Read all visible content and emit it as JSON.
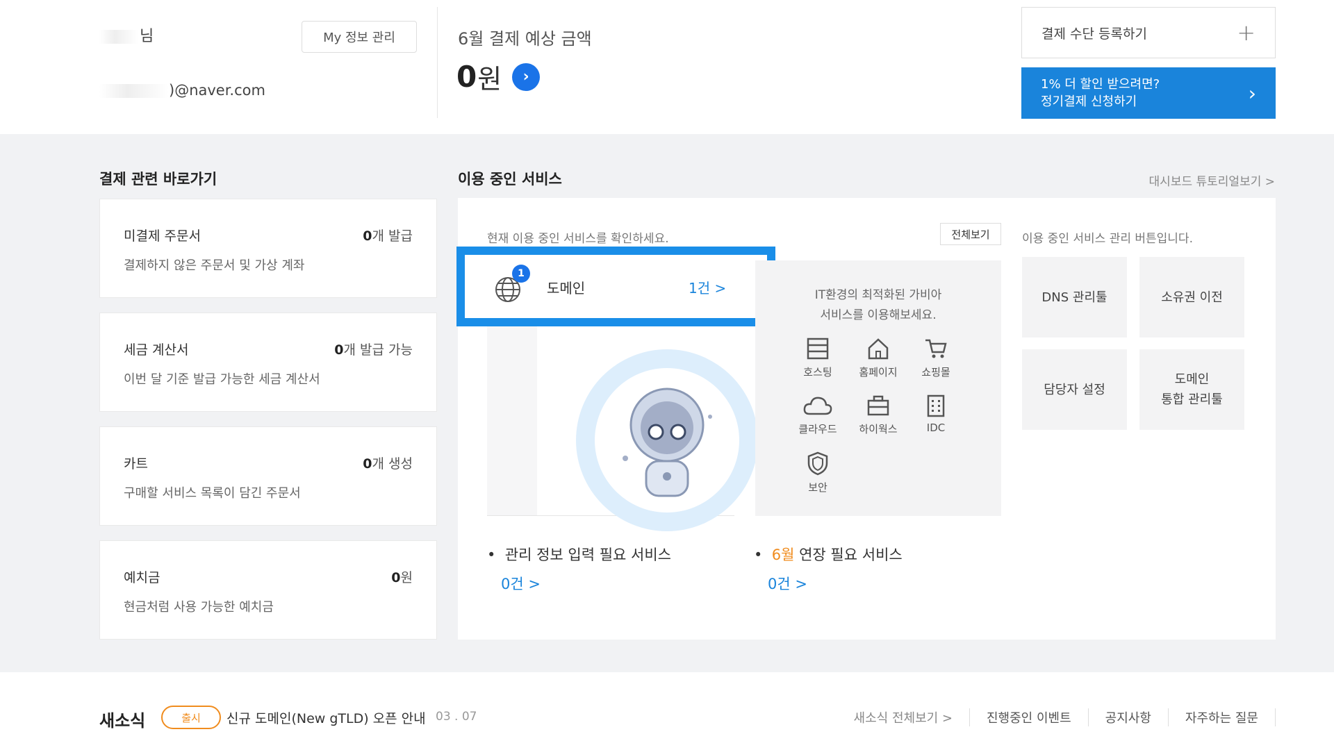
{
  "header": {
    "user_name_suffix": "님",
    "user_email_suffix": ")@naver.com",
    "myinfo_button": "My 정보 관리",
    "payment_title": "6월 결제 예상 금액",
    "payment_amount": "0",
    "payment_unit": "원",
    "register_payment": "결제 수단 등록하기",
    "discount_line1": "1% 더 할인 받으려면?",
    "discount_line2": "정기결제 신청하기"
  },
  "shortcuts": {
    "title": "결제 관련 바로가기",
    "cards": [
      {
        "label": "미결제 주문서",
        "value": "0",
        "value_suffix": "개 발급",
        "desc": "결제하지 않은 주문서 및 가상 계좌"
      },
      {
        "label": "세금 계산서",
        "value": "0",
        "value_suffix": "개 발급 가능",
        "desc": "이번 달 기준 발급 가능한 세금 계산서"
      },
      {
        "label": "카트",
        "value": "0",
        "value_suffix": "개 생성",
        "desc": "구매할 서비스 목록이 담긴 주문서"
      },
      {
        "label": "예치금",
        "value": "0",
        "value_suffix": "원",
        "desc": "현금처럼 사용 가능한 예치금"
      }
    ]
  },
  "services": {
    "title": "이용 중인 서비스",
    "tutorial_link": "대시보드 튜토리얼보기 >",
    "hint": "현재 이용 중인 서비스를 확인하세요.",
    "view_all": "전체보기",
    "mgmt_hint": "이용 중인 서비스 관리 버튼입니다.",
    "domain": {
      "badge": "1",
      "label": "도메인",
      "count": "1건 >"
    },
    "it_desc_line1": "IT환경의 최적화된 가비아",
    "it_desc_line2": "서비스를 이용해보세요.",
    "it_items": [
      {
        "label": "호스팅",
        "icon": "hosting-icon"
      },
      {
        "label": "홈페이지",
        "icon": "home-icon"
      },
      {
        "label": "쇼핑몰",
        "icon": "cart-icon"
      },
      {
        "label": "클라우드",
        "icon": "cloud-icon"
      },
      {
        "label": "하이웍스",
        "icon": "briefcase-icon"
      },
      {
        "label": "IDC",
        "icon": "server-icon"
      },
      {
        "label": "보안",
        "icon": "shield-icon"
      }
    ],
    "mgmt_buttons": [
      {
        "label": "DNS 관리툴"
      },
      {
        "label": "소유권 이전"
      },
      {
        "label": "담당자 설정"
      },
      {
        "label": "도메인\n통합 관리툴"
      }
    ],
    "footer": {
      "info_label": "관리 정보 입력 필요 서비스",
      "info_count": "0건 >",
      "renew_month": "6월",
      "renew_label": " 연장 필요 서비스",
      "renew_count": "0건 >"
    }
  },
  "news": {
    "title": "새소식",
    "badge": "출시",
    "text": "신규 도메인(New gTLD) 오픈 안내",
    "date": "03 . 07",
    "links": [
      "새소식 전체보기 >",
      "진행중인 이벤트",
      "공지사항",
      "자주하는 질문"
    ]
  },
  "colors": {
    "accent": "#1a84db",
    "highlight": "#f08c1e",
    "background": "#f1f2f4"
  }
}
